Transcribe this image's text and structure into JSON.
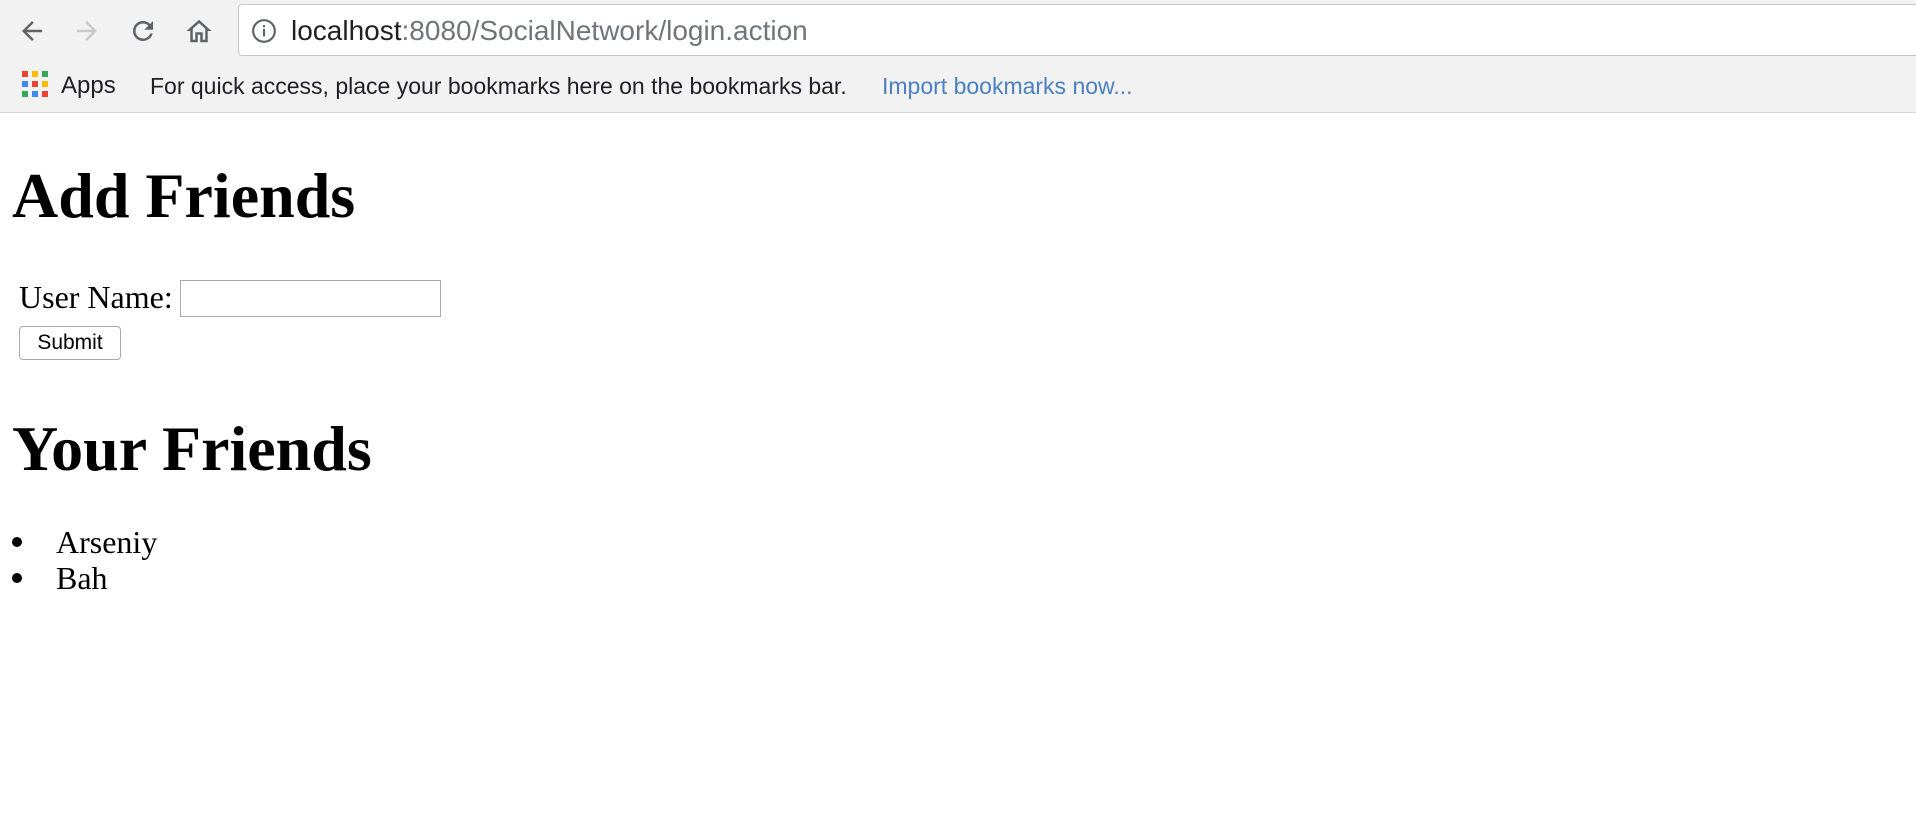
{
  "browser": {
    "url_host": "localhost",
    "url_rest": ":8080/SocialNetwork/login.action",
    "bookmarks_bar": {
      "apps_label": "Apps",
      "hint_text": "For quick access, place your bookmarks here on the bookmarks bar.",
      "import_link": "Import bookmarks now..."
    }
  },
  "page": {
    "add_heading": "Add Friends",
    "form": {
      "username_label": "User Name:",
      "username_value": "",
      "submit_label": "Submit"
    },
    "friends_heading": "Your Friends",
    "friends": [
      "Arseniy",
      "Bah"
    ]
  },
  "colors": {
    "link": "#4a7fc1",
    "toolbar_bg": "#f2f2f2",
    "apps_icon": [
      "#ea4335",
      "#fbbc05",
      "#34a853",
      "#4285f4",
      "#ea4335",
      "#fbbc05",
      "#34a853",
      "#4285f4",
      "#ea4335"
    ]
  },
  "icons": {
    "back": "back-arrow-icon",
    "forward": "forward-arrow-icon",
    "reload": "reload-icon",
    "home": "home-icon",
    "site_info": "info-icon",
    "apps": "apps-grid-icon"
  }
}
